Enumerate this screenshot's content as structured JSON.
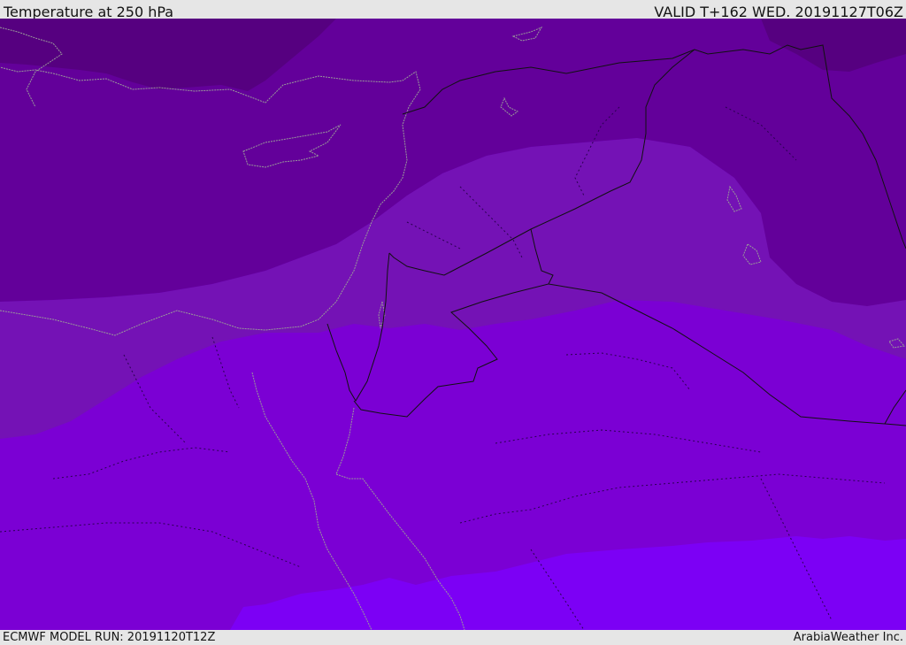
{
  "header": {
    "title": "Temperature at 250 hPa",
    "valid": "VALID T+162 WED. 20191127T06Z"
  },
  "footer": {
    "model_run": "ECMWF MODEL RUN: 20191120T12Z",
    "provider": "ArabiaWeather Inc."
  },
  "map": {
    "icon": "temperature-field-map",
    "colors": {
      "band_darkest": "#560080",
      "band_dark": "#63009a",
      "band_mid": "#7412b5",
      "band_light": "#7b00d4",
      "band_lightest": "#7c00f5",
      "coastline": "#9a9a9a",
      "border": "#111111"
    }
  }
}
